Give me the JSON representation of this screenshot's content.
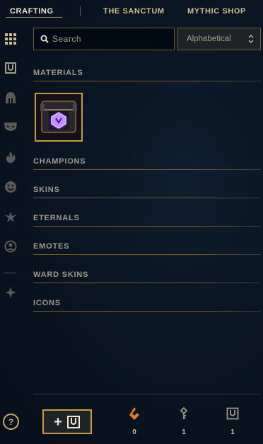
{
  "nav": {
    "tabs": [
      {
        "label": "CRAFTING",
        "active": true
      },
      {
        "label": "THE SANCTUM",
        "active": false
      },
      {
        "label": "MYTHIC SHOP",
        "active": false
      }
    ]
  },
  "sidebar": {
    "icons": [
      "grid-icon",
      "chest-icon",
      "helmet-icon",
      "mask-icon",
      "flame-icon",
      "smiley-icon",
      "ward-icon",
      "profile-icon",
      "tft-icon"
    ]
  },
  "search": {
    "placeholder": "Search",
    "value": ""
  },
  "sort": {
    "selected": "Alphabetical"
  },
  "sections": [
    {
      "title": "MATERIALS"
    },
    {
      "title": "CHAMPIONS"
    },
    {
      "title": "SKINS"
    },
    {
      "title": "ETERNALS"
    },
    {
      "title": "EMOTES"
    },
    {
      "title": "WARD SKINS"
    },
    {
      "title": "ICONS"
    }
  ],
  "materials": [
    {
      "name": "hextech-chest-icon"
    }
  ],
  "footer": {
    "help_label": "?",
    "add_label": "+",
    "currencies": [
      {
        "icon": "orange-essence-icon",
        "count": "0",
        "color": "#e8772e"
      },
      {
        "icon": "key-icon",
        "count": "1",
        "color": "#a09b8c"
      },
      {
        "icon": "chest-icon",
        "count": "1",
        "color": "#a09b8c"
      }
    ]
  },
  "colors": {
    "gold": "#c89b3c",
    "gold_light": "#cdbe91",
    "background": "#0a1523",
    "orange": "#e8772e"
  }
}
